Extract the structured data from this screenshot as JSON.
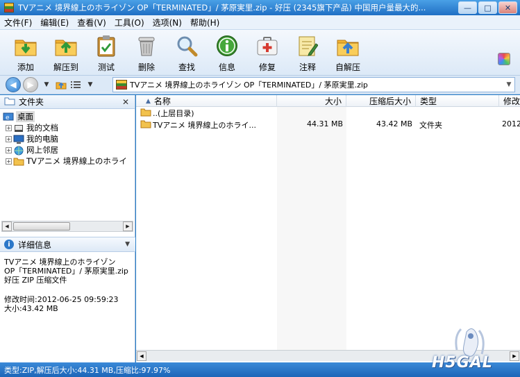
{
  "window": {
    "title": "TVアニメ 境界線上のホライゾン OP「TERMINATED」/ 茅原実里.zip - 好压 (2345旗下产品) 中国用户量最大的...",
    "buttons": {
      "minimize": "—",
      "maximize": "□",
      "close": "✕"
    }
  },
  "menu": [
    "文件(F)",
    "编辑(E)",
    "查看(V)",
    "工具(O)",
    "选项(N)",
    "帮助(H)"
  ],
  "toolbar": [
    {
      "label": "添加",
      "icon": "add-folder-icon"
    },
    {
      "label": "解压到",
      "icon": "extract-folder-icon"
    },
    {
      "label": "测试",
      "icon": "test-clipboard-icon"
    },
    {
      "label": "删除",
      "icon": "trash-icon"
    },
    {
      "label": "查找",
      "icon": "magnifier-icon"
    },
    {
      "label": "信息",
      "icon": "info-icon"
    },
    {
      "label": "修复",
      "icon": "first-aid-icon"
    },
    {
      "label": "注释",
      "icon": "notepad-icon"
    },
    {
      "label": "自解压",
      "icon": "self-extract-icon"
    }
  ],
  "address": {
    "path": "TVアニメ 境界線上のホライゾン OP「TERMINATED」/ 茅原実里.zip"
  },
  "left_panel": {
    "title": "文件夹",
    "tree": [
      {
        "label": "桌面",
        "icon": "desktop-icon",
        "selected": true
      },
      {
        "label": "我的文档",
        "icon": "my-documents-icon"
      },
      {
        "label": "我的电脑",
        "icon": "my-computer-icon"
      },
      {
        "label": "网上邻居",
        "icon": "network-icon"
      },
      {
        "label": "TVアニメ 境界線上のホライ",
        "icon": "folder-icon"
      }
    ],
    "details_title": "详细信息",
    "details": {
      "name_line1": "TVアニメ 境界線上のホライゾン",
      "name_line2": "OP「TERMINATED」/ 茅原実里.zip",
      "type": "好压 ZIP 压缩文件",
      "modified": "修改时间:2012-06-25 09:59:23",
      "size": "大小:43.42 MB"
    }
  },
  "file_list": {
    "columns": {
      "name": "名称",
      "size": "大小",
      "packed": "压缩后大小",
      "type": "类型",
      "modified": "修改"
    },
    "rows": [
      {
        "name": "..(上层目录)",
        "size": "",
        "packed": "",
        "type": "",
        "modified": ""
      },
      {
        "name": "TVアニメ 境界線上のホライ...",
        "size": "44.31 MB",
        "packed": "43.42 MB",
        "type": "文件夹",
        "modified": "2012"
      }
    ]
  },
  "status": "类型:ZIP,解压后大小:44.31 MB,压缩比:97.97%",
  "watermark": "H5GAL"
}
